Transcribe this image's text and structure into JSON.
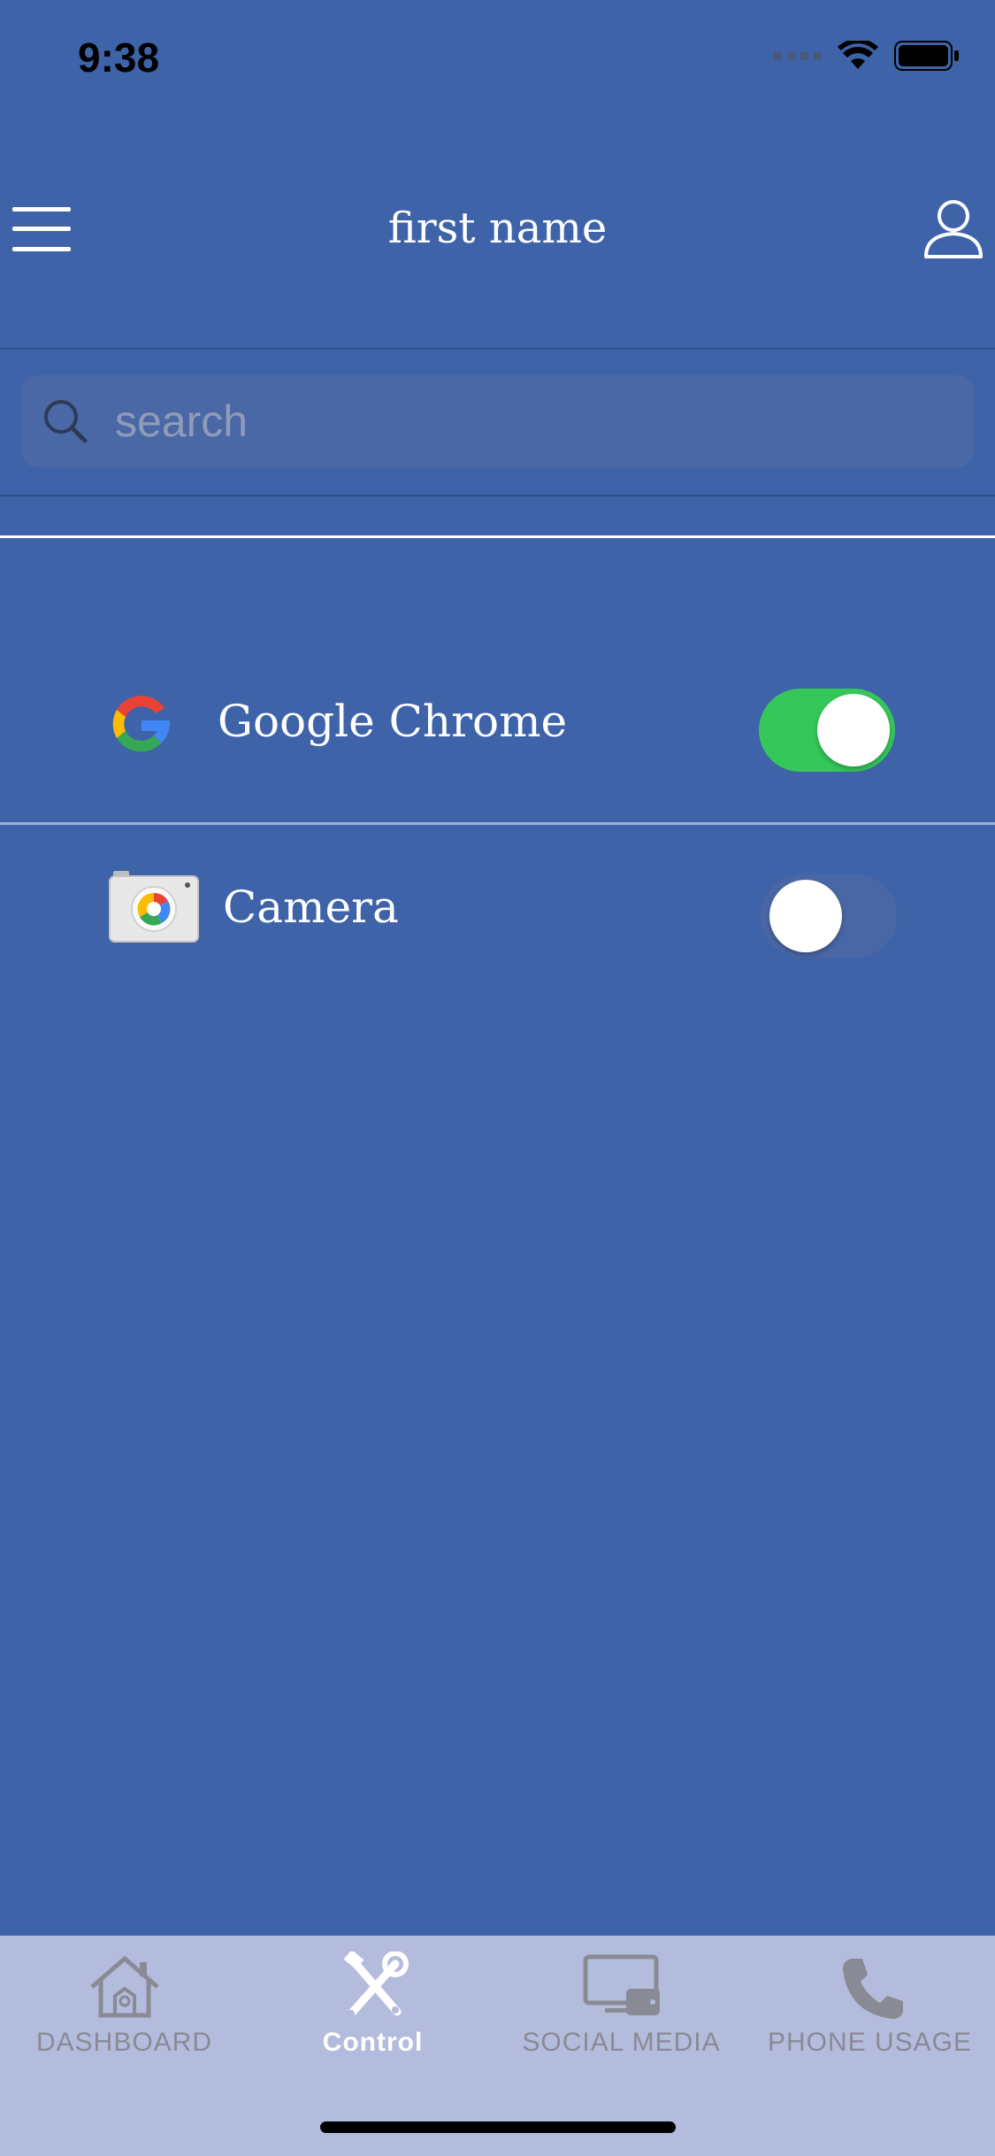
{
  "status_bar": {
    "time": "9:38"
  },
  "nav": {
    "title": "first name"
  },
  "search": {
    "placeholder": "search",
    "value": ""
  },
  "apps": [
    {
      "name": "Google Chrome",
      "enabled": true,
      "icon": "google-g-icon"
    },
    {
      "name": "Camera",
      "enabled": false,
      "icon": "camera-app-icon"
    }
  ],
  "tabs": [
    {
      "label": "DASHBOARD",
      "icon": "house-icon",
      "active": false
    },
    {
      "label": "Control",
      "icon": "tools-icon",
      "active": true
    },
    {
      "label": "SOCIAL MEDIA",
      "icon": "devices-icon",
      "active": false
    },
    {
      "label": "PHONE USAGE",
      "icon": "phone-icon",
      "active": false
    }
  ],
  "colors": {
    "background": "#3e63a9",
    "toggle_on": "#35c759",
    "tab_bar": "#b3bcdc"
  }
}
